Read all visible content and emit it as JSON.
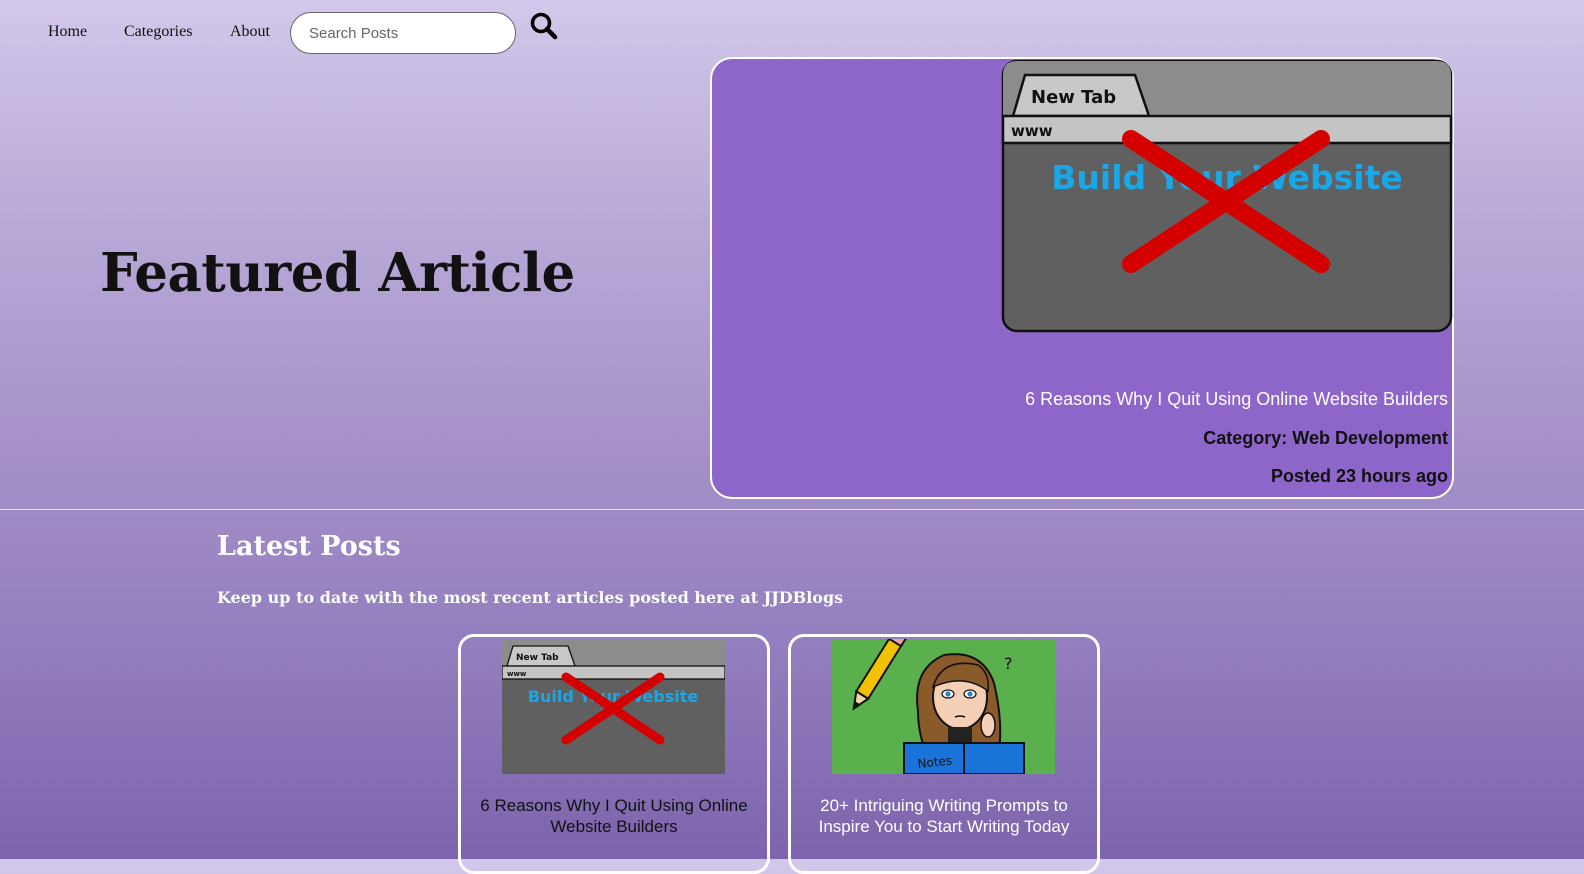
{
  "nav": {
    "links": [
      "Home",
      "Categories",
      "About"
    ],
    "search_placeholder": "Search Posts",
    "search_icon": "search-icon"
  },
  "featured": {
    "heading": "Featured Article",
    "image": {
      "tab_label": "New Tab",
      "url_label": "www",
      "banner_text": "Build Your Website",
      "overlay": "red-x"
    },
    "title": "6 Reasons Why I Quit Using Online Website Builders",
    "category": "Category: Web Development",
    "posted": "Posted 23 hours ago"
  },
  "latest": {
    "title": "Latest Posts",
    "subtitle": "Keep up to date with the most recent articles posted here at JJDBlogs",
    "posts": [
      {
        "title": "6 Reasons Why I Quit Using Online Website Builders",
        "image": {
          "tab_label": "New Tab",
          "url_label": "www",
          "banner_text": "Build Your Website"
        }
      },
      {
        "title": "20+ Intriguing Writing Prompts to Inspire You to Start Writing Today",
        "image": {
          "notebook_text": "Notes",
          "question_mark": "?"
        }
      }
    ]
  },
  "colors": {
    "featured_card": "#8e66c9",
    "accent_blue": "#1aa7e8",
    "red_x": "#d40000",
    "prompt_bg": "#5ab04c"
  }
}
